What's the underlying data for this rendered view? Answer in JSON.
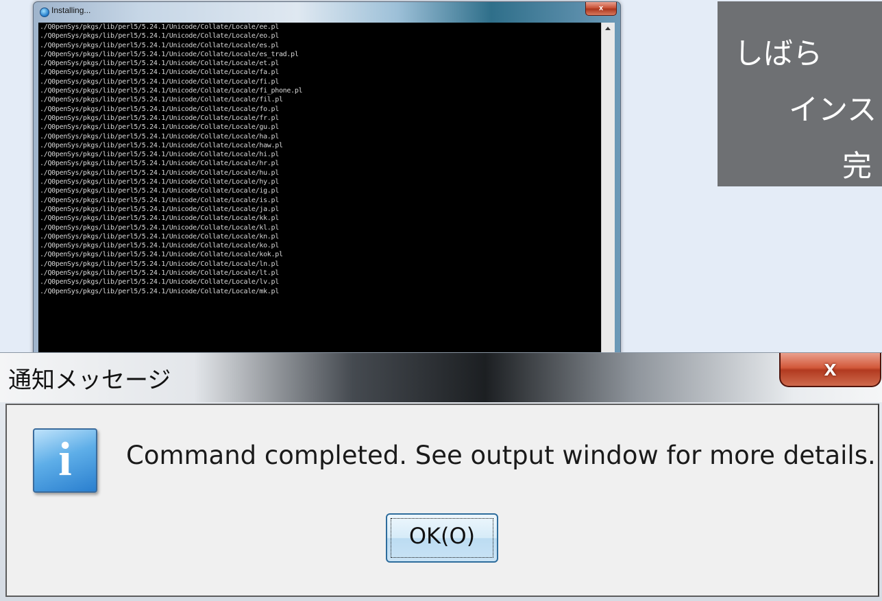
{
  "installer_window": {
    "title": "Installing...",
    "close_label": "x",
    "output_lines": [
      "./Q0penSys/pkgs/lib/perl5/5.24.1/Unicode/Collate/Locale/ee.pl",
      "./Q0penSys/pkgs/lib/perl5/5.24.1/Unicode/Collate/Locale/eo.pl",
      "./Q0penSys/pkgs/lib/perl5/5.24.1/Unicode/Collate/Locale/es.pl",
      "./Q0penSys/pkgs/lib/perl5/5.24.1/Unicode/Collate/Locale/es_trad.pl",
      "./Q0penSys/pkgs/lib/perl5/5.24.1/Unicode/Collate/Locale/et.pl",
      "./Q0penSys/pkgs/lib/perl5/5.24.1/Unicode/Collate/Locale/fa.pl",
      "./Q0penSys/pkgs/lib/perl5/5.24.1/Unicode/Collate/Locale/fi.pl",
      "./Q0penSys/pkgs/lib/perl5/5.24.1/Unicode/Collate/Locale/fi_phone.pl",
      "./Q0penSys/pkgs/lib/perl5/5.24.1/Unicode/Collate/Locale/fil.pl",
      "./Q0penSys/pkgs/lib/perl5/5.24.1/Unicode/Collate/Locale/fo.pl",
      "./Q0penSys/pkgs/lib/perl5/5.24.1/Unicode/Collate/Locale/fr.pl",
      "./Q0penSys/pkgs/lib/perl5/5.24.1/Unicode/Collate/Locale/gu.pl",
      "./Q0penSys/pkgs/lib/perl5/5.24.1/Unicode/Collate/Locale/ha.pl",
      "./Q0penSys/pkgs/lib/perl5/5.24.1/Unicode/Collate/Locale/haw.pl",
      "./Q0penSys/pkgs/lib/perl5/5.24.1/Unicode/Collate/Locale/hi.pl",
      "./Q0penSys/pkgs/lib/perl5/5.24.1/Unicode/Collate/Locale/hr.pl",
      "./Q0penSys/pkgs/lib/perl5/5.24.1/Unicode/Collate/Locale/hu.pl",
      "./Q0penSys/pkgs/lib/perl5/5.24.1/Unicode/Collate/Locale/hy.pl",
      "./Q0penSys/pkgs/lib/perl5/5.24.1/Unicode/Collate/Locale/ig.pl",
      "./Q0penSys/pkgs/lib/perl5/5.24.1/Unicode/Collate/Locale/is.pl",
      "./Q0penSys/pkgs/lib/perl5/5.24.1/Unicode/Collate/Locale/ja.pl",
      "./Q0penSys/pkgs/lib/perl5/5.24.1/Unicode/Collate/Locale/kk.pl",
      "./Q0penSys/pkgs/lib/perl5/5.24.1/Unicode/Collate/Locale/kl.pl",
      "./Q0penSys/pkgs/lib/perl5/5.24.1/Unicode/Collate/Locale/kn.pl",
      "./Q0penSys/pkgs/lib/perl5/5.24.1/Unicode/Collate/Locale/ko.pl",
      "./Q0penSys/pkgs/lib/perl5/5.24.1/Unicode/Collate/Locale/kok.pl",
      "./Q0penSys/pkgs/lib/perl5/5.24.1/Unicode/Collate/Locale/ln.pl",
      "./Q0penSys/pkgs/lib/perl5/5.24.1/Unicode/Collate/Locale/lt.pl",
      "./Q0penSys/pkgs/lib/perl5/5.24.1/Unicode/Collate/Locale/lv.pl",
      "./Q0penSys/pkgs/lib/perl5/5.24.1/Unicode/Collate/Locale/mk.pl"
    ]
  },
  "info_panel": {
    "lines": [
      "しばら",
      "インス",
      "完"
    ]
  },
  "dialog": {
    "title": "通知メッセージ",
    "close_label": "x",
    "message": "Command completed. See output window for more details.",
    "ok_label": "OK(O)"
  },
  "colors": {
    "desktop": "#e4ecf7",
    "console_bg": "#000000",
    "info_panel_bg": "#6e7073",
    "close_red": "#c44a2e",
    "info_icon_blue": "#2a7fcf"
  }
}
